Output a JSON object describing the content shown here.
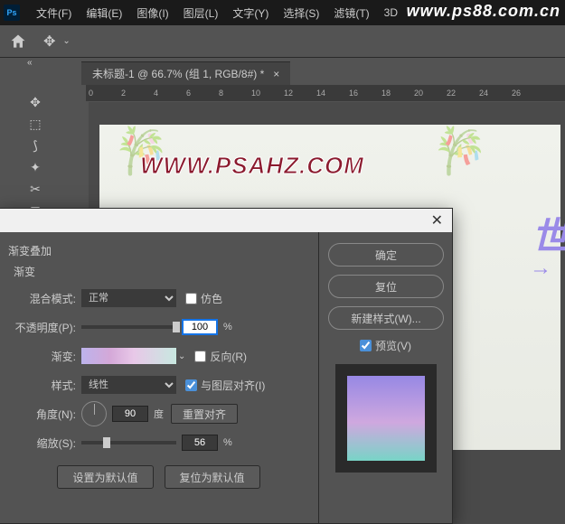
{
  "app": {
    "ps_badge": "Ps"
  },
  "menu": {
    "file": "文件(F)",
    "edit": "编辑(E)",
    "image": "图像(I)",
    "layer": "图层(L)",
    "type": "文字(Y)",
    "select": "选择(S)",
    "filter": "滤镜(T)",
    "three_d": "3D"
  },
  "watermark": "www.ps88.com.cn",
  "doc_tab": {
    "label": "未标题-1 @ 66.7% (组 1, RGB/8#) *",
    "close": "×"
  },
  "ruler": [
    "0",
    "2",
    "4",
    "6",
    "8",
    "10",
    "12",
    "14",
    "16",
    "18",
    "20",
    "22",
    "24",
    "26"
  ],
  "canvas": {
    "psahz": "WWW.PSAHZ.COM",
    "purple_char": "世",
    "arrow": "→"
  },
  "dialog": {
    "close": "✕",
    "title": "渐变叠加",
    "subtitle": "渐变",
    "blend_mode": {
      "label": "混合模式:",
      "value": "正常"
    },
    "dither": "仿色",
    "opacity": {
      "label": "不透明度(P):",
      "value": "100",
      "unit": "%"
    },
    "gradient": {
      "label": "渐变:"
    },
    "reverse": "反向(R)",
    "style": {
      "label": "样式:",
      "value": "线性"
    },
    "align": "与图层对齐(I)",
    "angle": {
      "label": "角度(N):",
      "value": "90",
      "unit": "度"
    },
    "reset_align": "重置对齐",
    "scale": {
      "label": "缩放(S):",
      "value": "56",
      "unit": "%"
    },
    "make_default": "设置为默认值",
    "reset_default": "复位为默认值",
    "ok": "确定",
    "reset": "复位",
    "new_style": "新建样式(W)...",
    "preview": "预览(V)"
  }
}
